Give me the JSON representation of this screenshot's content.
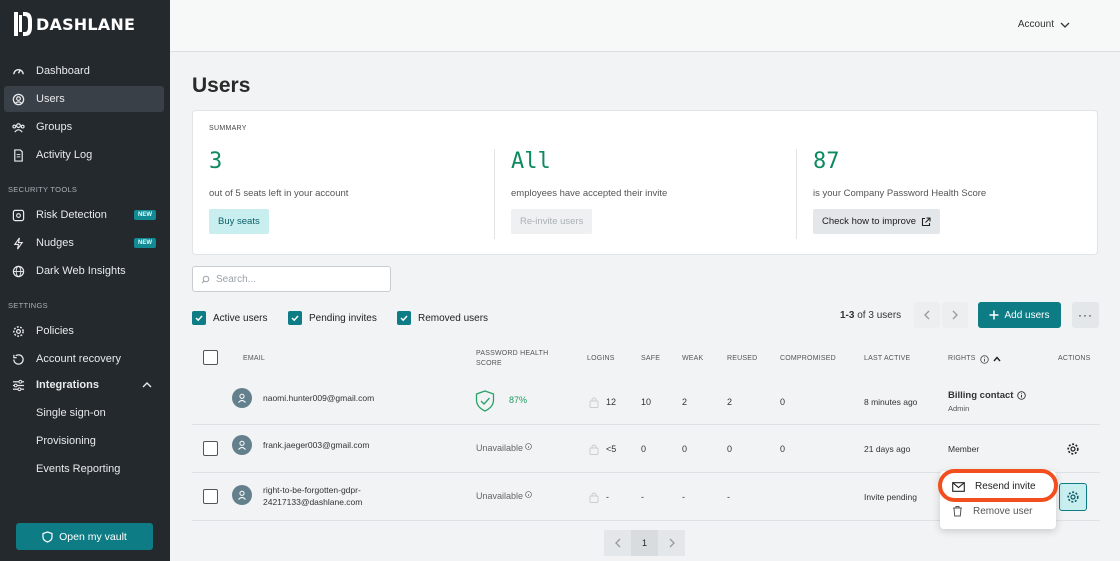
{
  "brand": {
    "name": "DASHLANE"
  },
  "sidebar": {
    "main_items": [
      {
        "label": "Dashboard",
        "icon": "gauge-icon"
      },
      {
        "label": "Users",
        "icon": "user-circle-icon"
      },
      {
        "label": "Groups",
        "icon": "group-icon"
      },
      {
        "label": "Activity Log",
        "icon": "document-icon"
      }
    ],
    "security_label": "SECURITY TOOLS",
    "security_items": [
      {
        "label": "Risk Detection",
        "badge": "NEW",
        "icon": "risk-icon"
      },
      {
        "label": "Nudges",
        "badge": "NEW",
        "icon": "lightning-icon"
      },
      {
        "label": "Dark Web Insights",
        "icon": "globe-icon"
      }
    ],
    "settings_label": "SETTINGS",
    "settings_items": [
      {
        "label": "Policies",
        "icon": "gear-icon"
      },
      {
        "label": "Account recovery",
        "icon": "recovery-icon"
      },
      {
        "label": "Integrations",
        "icon": "sliders-icon"
      },
      {
        "label": "Single sign-on"
      },
      {
        "label": "Provisioning"
      },
      {
        "label": "Events Reporting"
      }
    ],
    "vault_button": "Open my vault"
  },
  "header": {
    "account_label": "Account"
  },
  "page": {
    "title": "Users"
  },
  "summary": {
    "label": "SUMMARY",
    "seats": {
      "value": "3",
      "desc": "out of 5 seats left in your account",
      "button": "Buy seats"
    },
    "invites": {
      "value": "All",
      "desc": "employees have accepted their invite",
      "button": "Re-invite users"
    },
    "health": {
      "value": "87",
      "desc": "is your Company Password Health Score",
      "button": "Check how to improve"
    }
  },
  "search": {
    "placeholder": "Search..."
  },
  "filters": {
    "active": "Active users",
    "pending": "Pending invites",
    "removed": "Removed users"
  },
  "pagination": {
    "range": "1-3",
    "of_text": "of 3 users",
    "current_page": "1"
  },
  "add_users_button": "Add users",
  "table": {
    "headers": {
      "email": "EMAIL",
      "health_line1": "PASSWORD HEALTH",
      "health_line2": "SCORE",
      "logins": "LOGINS",
      "safe": "SAFE",
      "weak": "WEAK",
      "reused": "REUSED",
      "compromised": "COMPROMISED",
      "last_active": "LAST ACTIVE",
      "rights": "RIGHTS",
      "actions": "ACTIONS"
    },
    "rows": [
      {
        "email": "naomi.hunter009@gmail.com",
        "health": "87%",
        "logins": "12",
        "safe": "10",
        "weak": "2",
        "reused": "2",
        "compromised": "0",
        "last_active": "8 minutes ago",
        "rights": "Billing contact",
        "rights_sub": "Admin"
      },
      {
        "email": "frank.jaeger003@gmail.com",
        "health": "Unavailable",
        "logins": "<5",
        "safe": "0",
        "weak": "0",
        "reused": "0",
        "compromised": "0",
        "last_active": "21 days ago",
        "rights": "Member"
      },
      {
        "email_line1": "right-to-be-forgotten-gdpr-",
        "email_line2": "24217133@dashlane.com",
        "health": "Unavailable",
        "logins": "-",
        "safe": "-",
        "weak": "-",
        "reused": "-",
        "last_active": "Invite pending"
      }
    ]
  },
  "menu": {
    "resend": "Resend invite",
    "remove": "Remove user"
  },
  "colors": {
    "accent": "#0e7c85",
    "sidebar": "#24292e",
    "highlight": "#f24e1e",
    "success": "#0e8a5f"
  }
}
